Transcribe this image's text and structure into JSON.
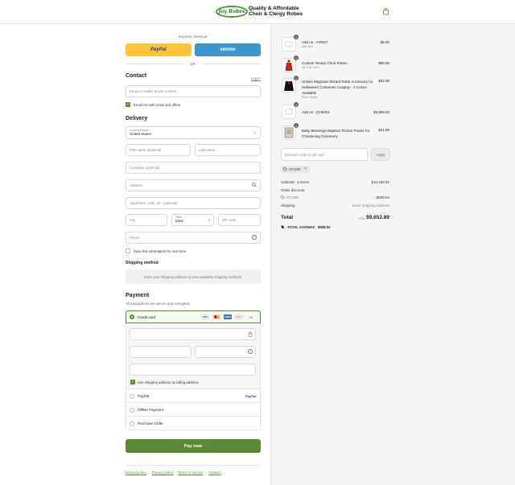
{
  "header": {
    "logo_script": "Joy Robes",
    "logo_line1": "Quality & Affordable",
    "logo_line2": "Choir & Clergy Robes"
  },
  "express": {
    "label": "Express checkout",
    "paypal": "PayPal",
    "venmo": "venmo",
    "or": "OR"
  },
  "contact": {
    "title": "Contact",
    "login": "Log in",
    "email_placeholder": "Email or mobile phone number",
    "news_label": "Email me with news and offers"
  },
  "delivery": {
    "title": "Delivery",
    "country_label": "Country/Region",
    "country_value": "United States",
    "first_name": "First name (optional)",
    "last_name": "Last name",
    "company": "Company (optional)",
    "address": "Address",
    "apartment": "Apartment, suite, etc. (optional)",
    "city": "City",
    "state_label": "State",
    "state_value": "Iowa",
    "zip": "ZIP code",
    "phone": "Phone",
    "save_info": "Save this information for next time"
  },
  "shipping": {
    "title": "Shipping method",
    "notice": "Enter your shipping address to view available shipping methods."
  },
  "payment": {
    "title": "Payment",
    "subtitle": "All transactions are secure and encrypted.",
    "credit_card": "Credit card",
    "more_cards": "+3",
    "billing_same": "Use shipping address as billing address",
    "paypal": "PayPal",
    "paypal_logo": "PayPal",
    "offline": "Offline Payment",
    "purchase_order": "Purchase Order",
    "pay_now": "Pay now"
  },
  "footer_links": [
    "Refund policy",
    "Privacy policy",
    "Terms of service",
    "Contact"
  ],
  "items": [
    {
      "qty": "1",
      "name": "Add on - CR027",
      "variant": "Add Text",
      "price": "$5.00"
    },
    {
      "qty": "1",
      "name": "Custom Tenuto Choir Robes",
      "variant": "18 1/16\" 4'8\"1",
      "price": "$99.95"
    },
    {
      "qty": "1",
      "name": "Unisex Magician Wizard Robe Accessory for Halloween Costumes Cosplay - 2 Colors Available",
      "variant": "Red / Small",
      "price": "$34.99"
    },
    {
      "qty": "1",
      "name": "Add on - CH5001",
      "variant": "",
      "price": "$9,999.00"
    },
    {
      "qty": "1",
      "name": "Baby Blessings Baptism Picture Frame for Christening Ceremony",
      "variant": "",
      "price": "$21.99"
    }
  ],
  "discount": {
    "placeholder": "Discount code or gift card",
    "apply": "Apply",
    "code": "IVY100"
  },
  "summary": {
    "subtotal_label": "Subtotal · 5 items",
    "subtotal_value": "$10,160.91",
    "order_discount_label": "Order discount",
    "discount_code": "IVY100",
    "discount_value": "- $508.04",
    "shipping_label": "Shipping",
    "shipping_value": "Enter shipping address",
    "total_label": "Total",
    "currency": "USD",
    "total_value": "$9,652.89",
    "savings_label": "TOTAL SAVINGS",
    "savings_value": "$508.04"
  },
  "colors": {
    "accent_green": "#5a8a33",
    "paypal_yellow": "#ffc439",
    "venmo_blue": "#3d95ce"
  }
}
